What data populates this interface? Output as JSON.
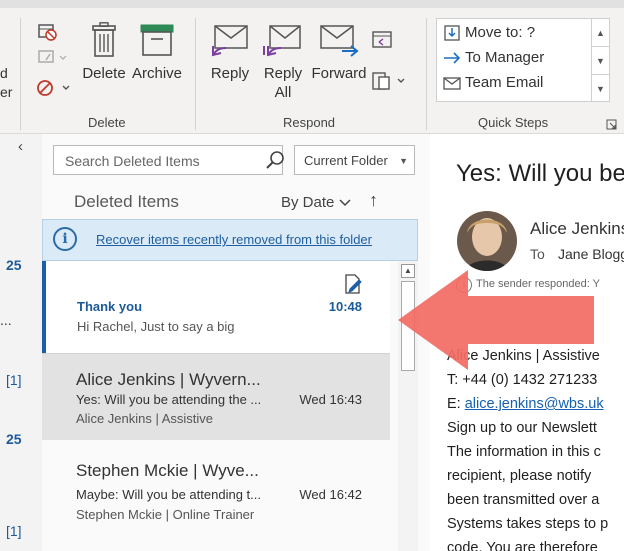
{
  "ribbon": {
    "delete_group": {
      "label": "Delete",
      "delete_label": "Delete",
      "archive_label": "Archive"
    },
    "respond_group": {
      "label": "Respond",
      "reply_label": "Reply",
      "reply_all_label_1": "Reply",
      "reply_all_label_2": "All",
      "forward_label": "Forward"
    },
    "quick_steps_group": {
      "label": "Quick Steps",
      "items": [
        {
          "label": "Move to: ?"
        },
        {
          "label": "To Manager"
        },
        {
          "label": "Team Email"
        }
      ]
    },
    "cut_left_fragment_1": "d",
    "cut_left_fragment_2": "er"
  },
  "left_strip": {
    "counts": [
      "25",
      "[1]",
      "25",
      "[1]"
    ],
    "ellipsis": "..."
  },
  "message_list": {
    "search_placeholder": "Search Deleted Items",
    "scope": "Current Folder",
    "title": "Deleted Items",
    "sort_label": "By Date",
    "sort_direction": "↑",
    "info_bar_link": "Recover items recently removed from this folder",
    "messages": [
      {
        "sender": "Thank you",
        "preview": "Hi Rachel,  Just to say a big",
        "time": "10:48",
        "state": "selected"
      },
      {
        "sender": "Alice Jenkins  | Wyvern...",
        "subject": "Yes: Will you be attending the ...",
        "preview": "Alice Jenkins | Assistive",
        "time": "Wed 16:43",
        "state": "hover"
      },
      {
        "sender": "Stephen Mckie | Wyve...",
        "subject": "Maybe: Will you be attending t...",
        "preview": "Stephen Mckie | Online Trainer",
        "time": "Wed 16:42",
        "state": "normal"
      }
    ]
  },
  "reading_pane": {
    "subject": "Yes: Will you be",
    "from": "Alice Jenkins",
    "to_label": "To",
    "to": "Jane Blogg",
    "info": "The sender responded: Y",
    "body_lines": [
      "Alice Jenkins | Assistive",
      "T: +44 (0) 1432 271233",
      "E: ",
      "Sign up to our Newslett",
      "The information in this c",
      "recipient, please notify",
      "been transmitted over a",
      "Systems takes steps to p",
      "code. You are therefore"
    ],
    "email_link": "alice.jenkins@wbs.uk"
  },
  "colors": {
    "accent": "#1b5fa8",
    "arrow": "#f26b63",
    "info_bar": "#dbeaf7",
    "hover_row": "#e2e2e2"
  }
}
